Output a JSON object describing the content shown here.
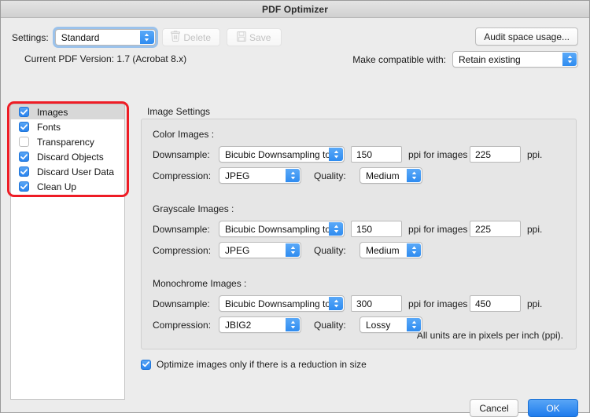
{
  "window": {
    "title": "PDF Optimizer"
  },
  "toolbar": {
    "settings_label": "Settings:",
    "settings_value": "Standard",
    "delete_label": "Delete",
    "save_label": "Save",
    "audit_label": "Audit space usage...",
    "version_text": "Current PDF Version: 1.7 (Acrobat 8.x)",
    "compat_label": "Make compatible with:",
    "compat_value": "Retain existing"
  },
  "sidebar": {
    "items": [
      {
        "label": "Images",
        "checked": true,
        "selected": true
      },
      {
        "label": "Fonts",
        "checked": true,
        "selected": false
      },
      {
        "label": "Transparency",
        "checked": false,
        "selected": false
      },
      {
        "label": "Discard Objects",
        "checked": true,
        "selected": false
      },
      {
        "label": "Discard User Data",
        "checked": true,
        "selected": false
      },
      {
        "label": "Clean Up",
        "checked": true,
        "selected": false
      }
    ]
  },
  "main": {
    "panel_title": "Image Settings",
    "downsample_label": "Downsample:",
    "compression_label": "Compression:",
    "quality_label": "Quality:",
    "ppi_for_label": "ppi for images above",
    "ppi_suffix": "ppi.",
    "units_note": "All units are in pixels per inch (ppi).",
    "sections": [
      {
        "title": "Color Images :",
        "downsample_method": "Bicubic Downsampling to",
        "downsample_ppi": "150",
        "above_ppi": "225",
        "compression": "JPEG",
        "quality": "Medium"
      },
      {
        "title": "Grayscale Images :",
        "downsample_method": "Bicubic Downsampling to",
        "downsample_ppi": "150",
        "above_ppi": "225",
        "compression": "JPEG",
        "quality": "Medium"
      },
      {
        "title": "Monochrome Images :",
        "downsample_method": "Bicubic Downsampling to",
        "downsample_ppi": "300",
        "above_ppi": "450",
        "compression": "JBIG2",
        "quality": "Lossy"
      }
    ]
  },
  "footer": {
    "optimize_checkbox_label": "Optimize images only if there is a reduction in size",
    "optimize_checked": true,
    "cancel_label": "Cancel",
    "ok_label": "OK"
  },
  "colors": {
    "accent_blue": "#2a84ee",
    "annotation_red": "#ee1c25",
    "window_bg": "#ececec",
    "panel_bg": "#e6e6e6"
  }
}
